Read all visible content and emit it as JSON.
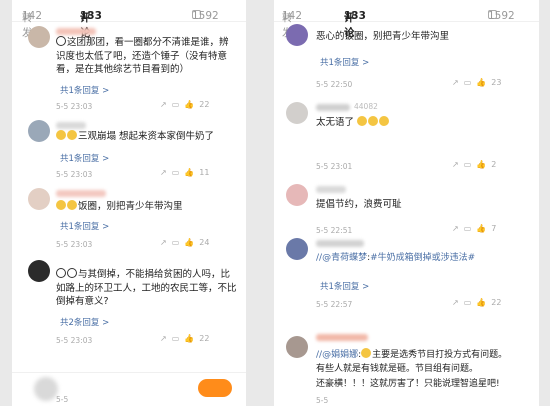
{
  "left": {
    "tabs": {
      "repost": "转发",
      "repost_count": "142",
      "comment": "评论",
      "comment_count": "133",
      "like_count": "1592"
    },
    "comments": [
      {
        "text": "这团那团，看一圈都分不清谁是谁，辨识度也太低了吧，还造个锤子（没有特意看，是在其他综艺节目看到的）",
        "reply": "共1条回复 >",
        "date": "5-5 23:03",
        "likes": "22"
      },
      {
        "text": "三观崩塌 想起来资本家倒牛奶了",
        "reply": "共1条回复 >",
        "date": "5-5 23:03",
        "likes": "11"
      },
      {
        "text": "饭圈，别把青少年带沟里",
        "reply": "共1条回复 >",
        "date": "5-5 23:03",
        "likes": "24"
      },
      {
        "text": "与其倒掉，不能捐给贫困的人吗，比如路上的环卫工人，工地的农民工等，不比倒掉有意义?",
        "reply": "共2条回复 >",
        "date": "5-5 23:03",
        "likes": "22"
      },
      {
        "date": "5-5"
      }
    ]
  },
  "right": {
    "tabs": {
      "repost": "转发",
      "repost_count": "142",
      "comment": "评论",
      "comment_count": "133",
      "like_count": "1592"
    },
    "comments": [
      {
        "text": "恶心的饭圈，别把青少年带沟里",
        "reply": "共1条回复 >",
        "date": "5-5 22:50",
        "likes": "23"
      },
      {
        "name_partial": "44082",
        "text": "太无语了",
        "date": "5-5 23:01",
        "likes": "2"
      },
      {
        "text": "提倡节约，浪费可耻",
        "date": "5-5 22:51",
        "likes": "7"
      },
      {
        "mention": "//@青荷蝶梦",
        "hashtag": "#牛奶成箱倒掉或涉违法#",
        "reply": "共1条回复 >",
        "date": "5-5 22:57",
        "likes": "22"
      },
      {
        "mention": "//@娟娟娜",
        "text_1": "主要是选秀节目打投方式有问题。",
        "text_2": "有些人就是有钱就是砸。节目组有问题。",
        "text_3": "还豪横！！！这就厉害了！只能说理智追星吧!",
        "date": "5-5"
      }
    ]
  },
  "colors": {
    "link": "#4a6fa5",
    "send": "#ff8c1a"
  }
}
